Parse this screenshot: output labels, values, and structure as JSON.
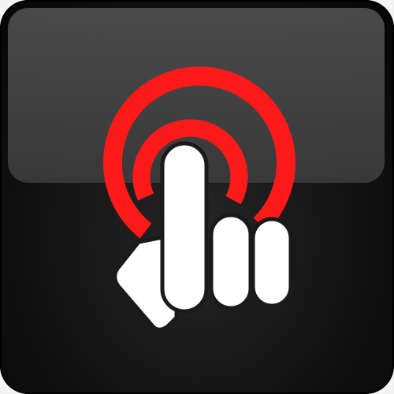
{
  "icon": {
    "name": "touch-target-icon",
    "colors": {
      "background": "#131313",
      "gloss": "#454545",
      "rings": "#ff1a1a",
      "hand": "#ffffff"
    }
  }
}
